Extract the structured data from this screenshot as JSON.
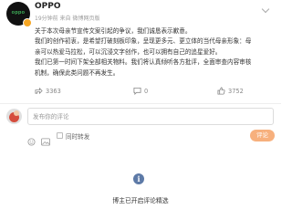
{
  "post": {
    "username": "OPPO",
    "meta": "19分钟前 来自 微博网页版",
    "lines": [
      "关于本次母亲节宣传文案引起的争议，我们诚恳表示歉意。",
      "我们的创作初衷，是希望打破刻板印象，呈现更多元、更立体的当代母亲形象：母",
      "亲可以热爱马拉松，可以沉浸文字创作，也可以拥有自己的追星爱好。",
      "我们已第一时间下架全部相关物料。我们将认真倾听各方批评，全面审查内容审核",
      "机制，确保此类问题不再发生。"
    ]
  },
  "actions": {
    "share_count": "3363",
    "comment_count": "0",
    "like_count": "3752"
  },
  "comment": {
    "placeholder": "发布你的评论",
    "repost_label": "同时转发",
    "submit_label": "评论"
  },
  "notice": {
    "text": "博主已开启评论精选"
  },
  "colors": {
    "accent": "#f7b07d",
    "info": "#5d7aa7",
    "verified": "#f6a623"
  }
}
